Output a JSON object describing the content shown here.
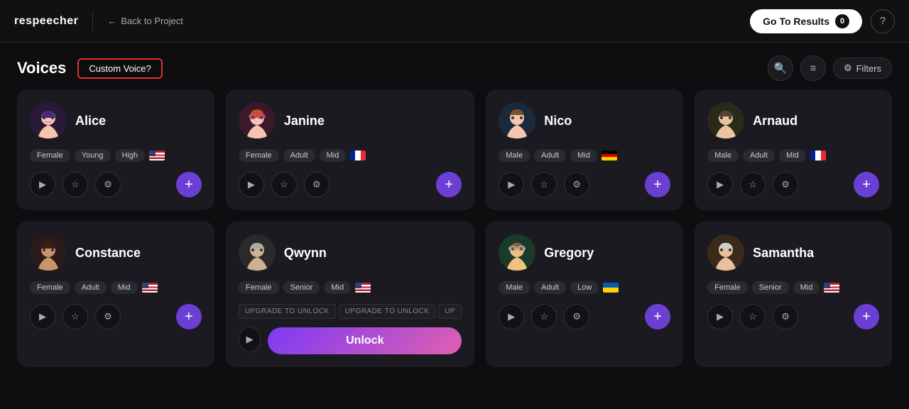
{
  "header": {
    "logo": "respeecher",
    "back_label": "Back to Project",
    "go_to_results": "Go To Results",
    "results_count": "0",
    "help_icon": "?"
  },
  "sub_header": {
    "title": "Voices",
    "custom_voice_label": "Custom Voice?",
    "filters_label": "Filters"
  },
  "voices": [
    {
      "id": "alice",
      "name": "Alice",
      "avatar_emoji": "🧝‍♀️",
      "avatar_class": "avatar-alice",
      "tags": [
        "Female",
        "Young",
        "High"
      ],
      "flag": "🇺🇸",
      "locked": false
    },
    {
      "id": "janine",
      "name": "Janine",
      "avatar_emoji": "👩‍🦰",
      "avatar_class": "avatar-janine",
      "tags": [
        "Female",
        "Adult",
        "Mid"
      ],
      "flag": "🇫🇷",
      "locked": false
    },
    {
      "id": "nico",
      "name": "Nico",
      "avatar_emoji": "🧕",
      "avatar_class": "avatar-nico",
      "tags": [
        "Male",
        "Adult",
        "Mid"
      ],
      "flag": "🇩🇪",
      "locked": false
    },
    {
      "id": "arnaud",
      "name": "Arnaud",
      "avatar_emoji": "👨",
      "avatar_class": "avatar-arnaud",
      "tags": [
        "Male",
        "Adult",
        "Mid"
      ],
      "flag": "🇫🇷",
      "locked": false
    },
    {
      "id": "constance",
      "name": "Constance",
      "avatar_emoji": "👩",
      "avatar_class": "avatar-constance",
      "tags": [
        "Female",
        "Adult",
        "Mid"
      ],
      "flag": "🇺🇸",
      "locked": false
    },
    {
      "id": "qwynn",
      "name": "Qwynn",
      "avatar_emoji": "👴",
      "avatar_class": "avatar-qwynn",
      "tags": [
        "Female",
        "Senior",
        "Mid"
      ],
      "flag": "🇺🇸",
      "locked": true,
      "unlock_tags": [
        "UPGRADE TO UNLOCK",
        "UPGRADE TO UNLOCK",
        "UP"
      ],
      "unlock_label": "Unlock"
    },
    {
      "id": "gregory",
      "name": "Gregory",
      "avatar_emoji": "👨‍🦱",
      "avatar_class": "avatar-gregory",
      "tags": [
        "Male",
        "Adult",
        "Low"
      ],
      "flag": "🇺🇦",
      "locked": false
    },
    {
      "id": "samantha",
      "name": "Samantha",
      "avatar_emoji": "👩‍🦳",
      "avatar_class": "avatar-samantha",
      "tags": [
        "Female",
        "Senior",
        "Mid"
      ],
      "flag": "🇺🇸",
      "locked": false
    }
  ]
}
